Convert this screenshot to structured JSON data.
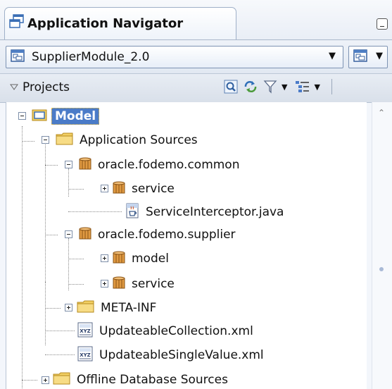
{
  "navigator": {
    "title": "Application Navigator",
    "application": "SupplierModule_2.0",
    "projects_label": "Projects"
  },
  "tree": {
    "model": "Model",
    "application_sources": "Application Sources",
    "pkg_common": "oracle.fodemo.common",
    "pkg_common_service": "service",
    "service_interceptor": "ServiceInterceptor.java",
    "pkg_supplier": "oracle.fodemo.supplier",
    "pkg_supplier_model": "model",
    "pkg_supplier_service": "service",
    "meta_inf": "META-INF",
    "updateable_collection": "UpdateableCollection.xml",
    "updateable_single_value": "UpdateableSingleValue.xml",
    "offline_db_sources": "Offline Database Sources"
  },
  "colors": {
    "selection": "#4a7bc8",
    "folder": "#f2cf63",
    "package": "#c9822e"
  }
}
